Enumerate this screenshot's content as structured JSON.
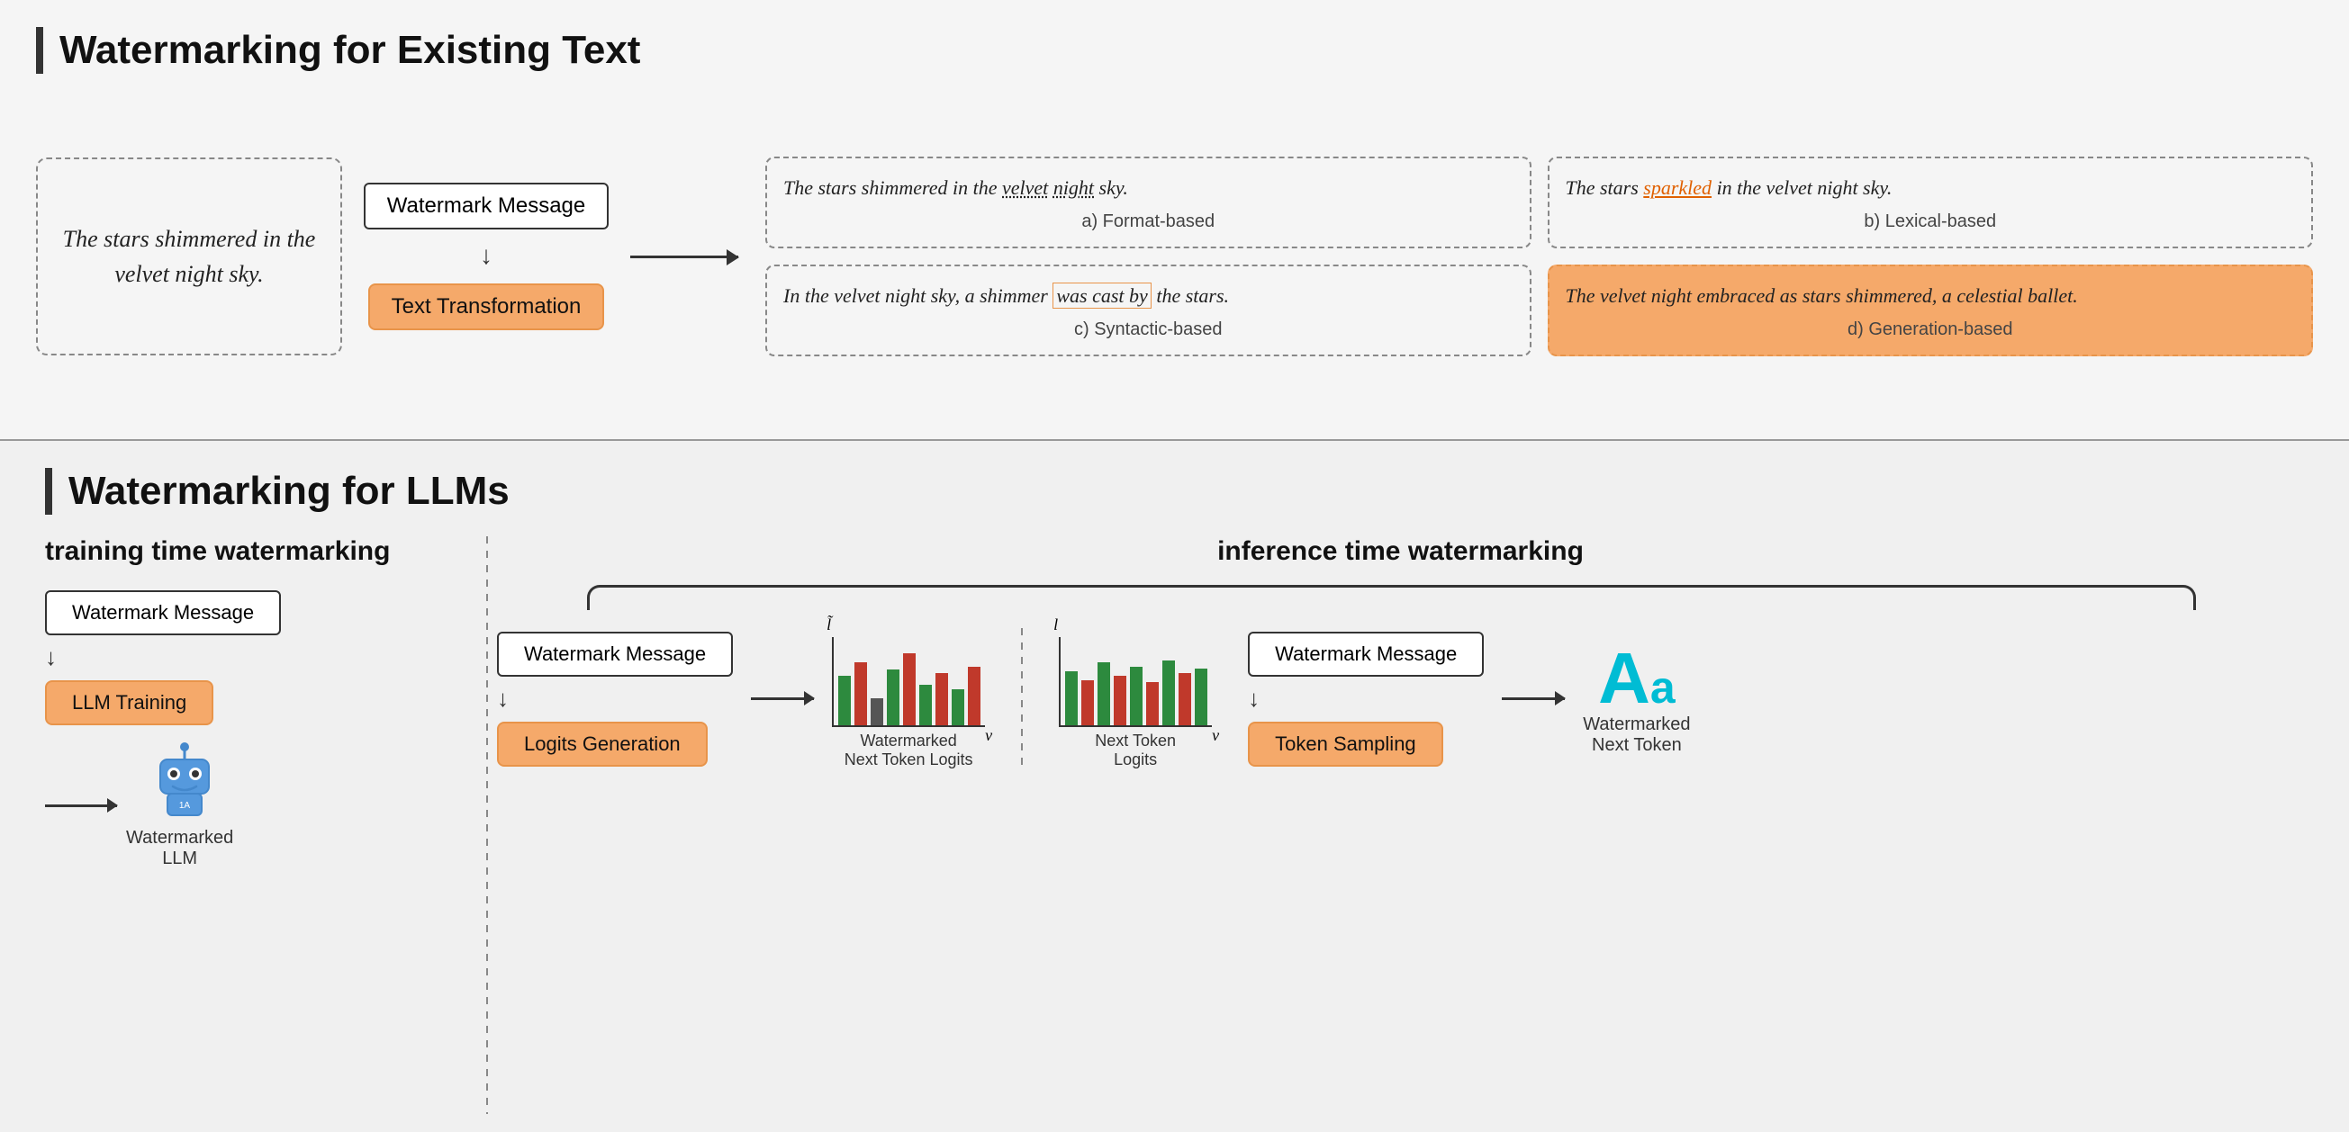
{
  "top_section": {
    "title": "Watermarking for Existing Text",
    "original_text": "The stars shimmered in the velvet night sky.",
    "watermark_message": "Watermark Message",
    "text_transformation": "Text Transformation",
    "result_a": {
      "text_parts": [
        "The stars shimmered in the ",
        "velvet",
        " ",
        "night",
        " sky."
      ],
      "underlines": [
        1,
        3
      ],
      "label": "a) Format-based"
    },
    "result_b": {
      "text": "The stars ",
      "highlighted": "sparkled",
      "rest": " in the velvet night sky.",
      "label": "b) Lexical-based"
    },
    "result_c": {
      "text1": "In the velvet night sky, a shimmer ",
      "boxed": "was cast by",
      "text2": " the stars.",
      "label": "c) Syntactic-based"
    },
    "result_d": {
      "text": "The velvet night embraced as stars shimmered, a celestial ballet.",
      "label": "d) Generation-based"
    }
  },
  "bottom_section": {
    "title": "Watermarking for LLMs",
    "training": {
      "subtitle": "training time watermarking",
      "watermark_message": "Watermark Message",
      "llm_training": "LLM Training",
      "llm_label": "Watermarked\nLLM"
    },
    "inference": {
      "subtitle": "inference time watermarking",
      "flow1": {
        "watermark_message": "Watermark Message",
        "logits_generation": "Logits Generation",
        "chart_label_y": "l̃",
        "chart_label_x": "v",
        "caption": "Watermarked\nNext Token Logits"
      },
      "middle": {
        "chart_label_y": "l",
        "chart_label_x": "v",
        "caption": "Next Token\nLogits"
      },
      "flow2": {
        "watermark_message": "Watermark Message",
        "token_sampling": "Token Sampling",
        "token_caption": "Watermarked\nNext Token"
      }
    }
  }
}
